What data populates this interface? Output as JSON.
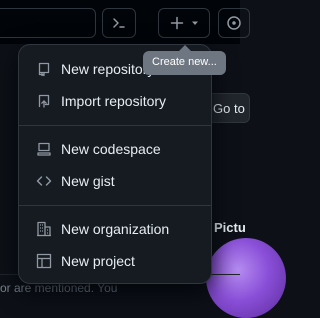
{
  "header": {
    "command_icon": "terminal-icon",
    "create_icon": "plus-icon",
    "create_caret_icon": "triangle-down-icon",
    "issues_icon": "issue-opened-icon"
  },
  "tooltip": {
    "text": "Create new..."
  },
  "menu": {
    "items": [
      {
        "label": "New repository",
        "icon": "repo-icon"
      },
      {
        "label": "Import repository",
        "icon": "repo-push-icon"
      },
      {
        "label": "New codespace",
        "icon": "codespaces-icon"
      },
      {
        "label": "New gist",
        "icon": "code-icon"
      },
      {
        "label": "New organization",
        "icon": "organization-icon"
      },
      {
        "label": "New project",
        "icon": "project-icon"
      }
    ]
  },
  "background": {
    "goto_label": "Go to",
    "heading_fragment": "Pictu",
    "mention_fragment": "or are mentioned. You"
  },
  "colors": {
    "page_bg": "#0d1117",
    "menu_bg": "#161b22",
    "border": "#30363d",
    "text": "#e6edf3",
    "icon": "#9198a1",
    "tooltip_bg": "#6e7681"
  }
}
